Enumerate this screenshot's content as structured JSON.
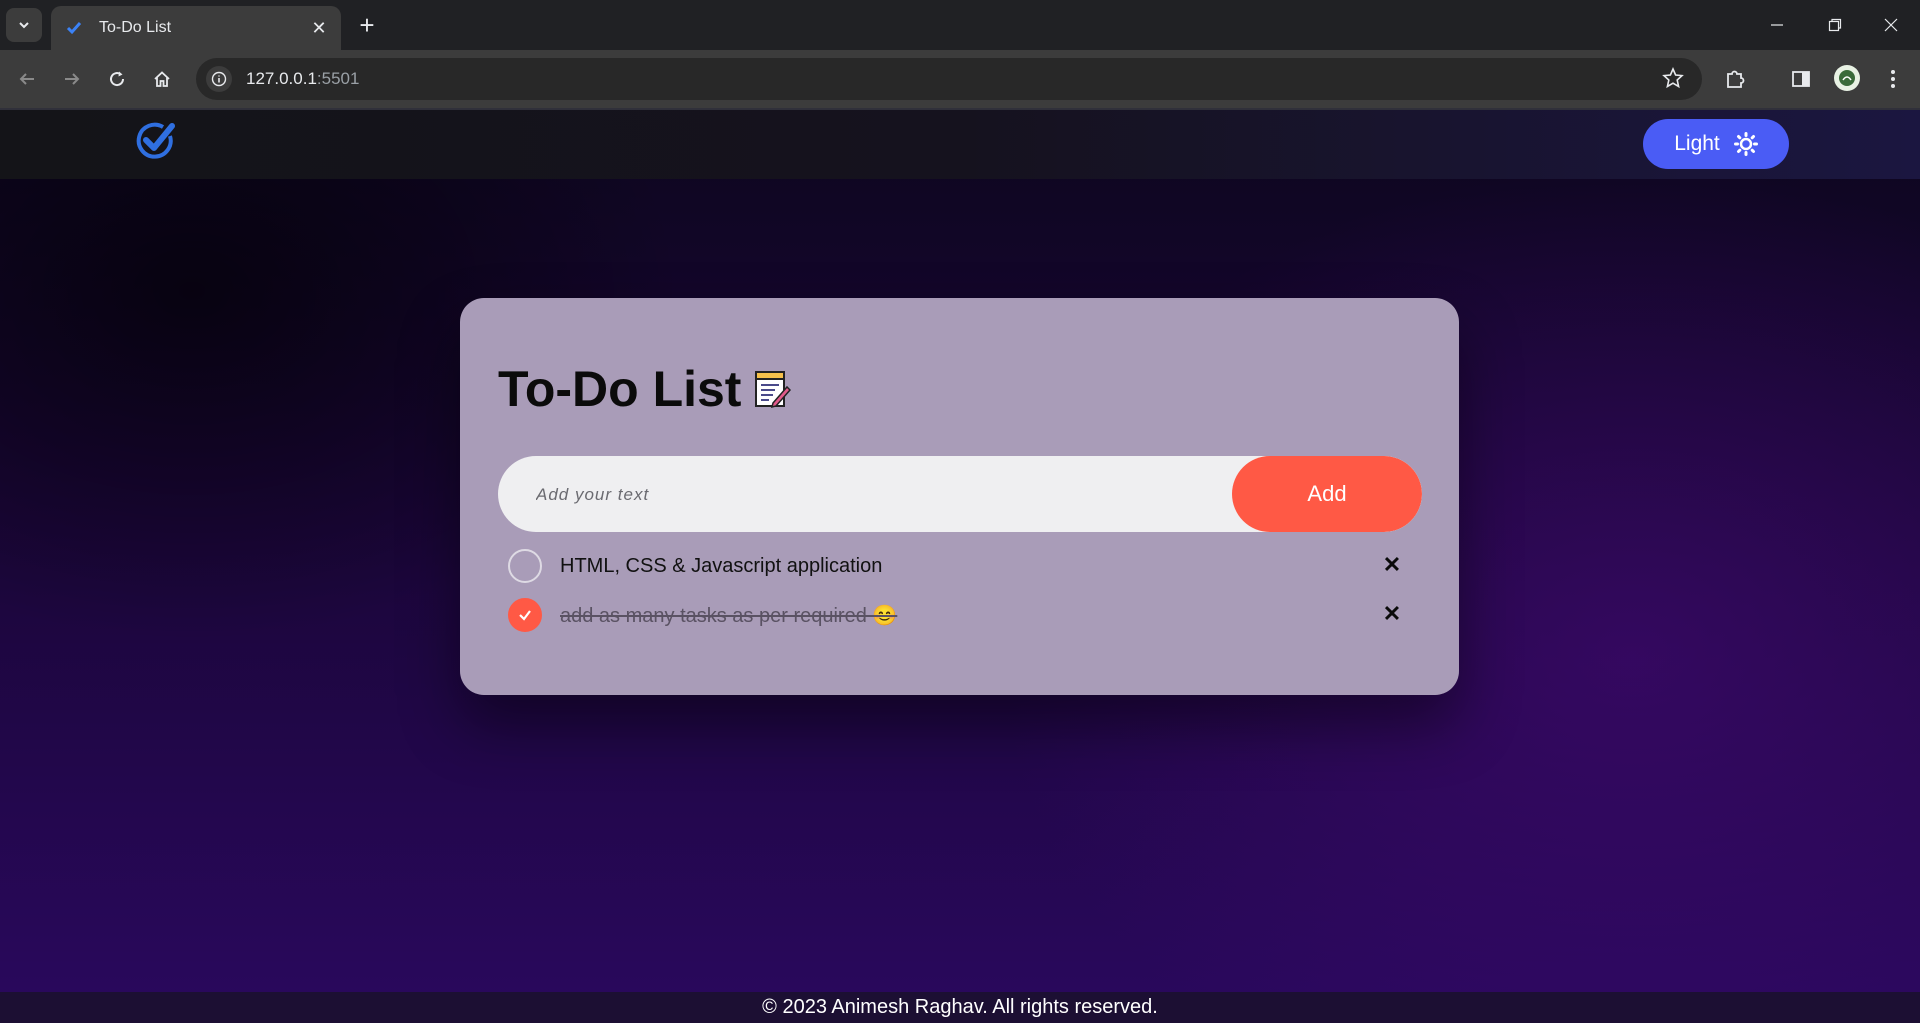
{
  "browser": {
    "tab_title": "To-Do List",
    "tab_close": "✕",
    "new_tab": "+",
    "url_host": "127.0.0.1",
    "url_port": ":5501"
  },
  "navbar": {
    "theme_label": "Light",
    "theme_button_color": "#4a5cf5"
  },
  "app": {
    "title": "To-Do List",
    "input_placeholder": "Add your text",
    "add_label": "Add",
    "accent_color": "#ff5945",
    "tasks": [
      {
        "text": "HTML, CSS & Javascript application",
        "done": false,
        "delete": "✕"
      },
      {
        "text": "add as many tasks as per required 😊",
        "done": true,
        "delete": "✕"
      }
    ]
  },
  "footer": {
    "text": "© 2023 Animesh Raghav. All rights reserved."
  }
}
